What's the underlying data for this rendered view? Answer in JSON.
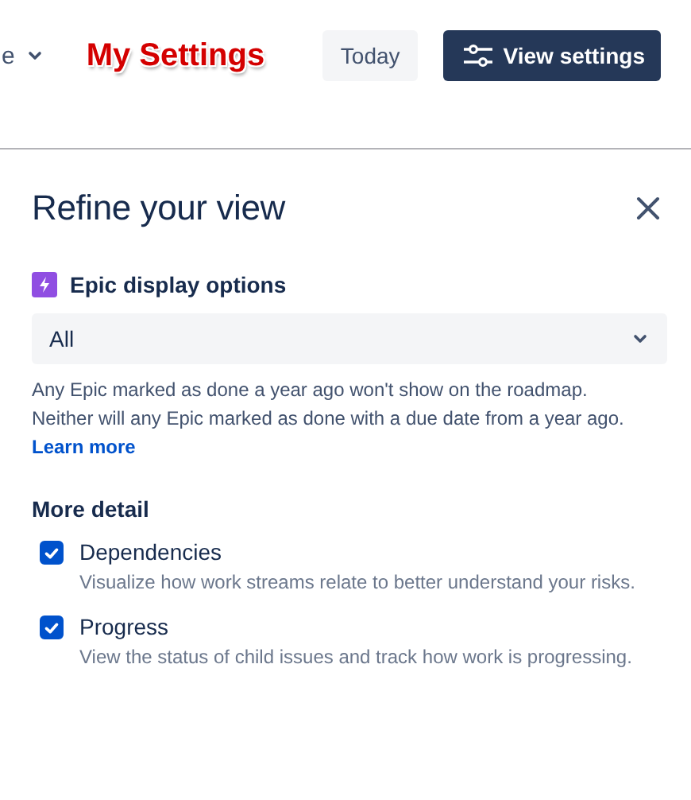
{
  "header": {
    "view_dropdown": {
      "label": "e"
    },
    "annotation": "My Settings",
    "buttons": [
      {
        "label": "Today",
        "kind": "subtle"
      },
      {
        "label": "View settings",
        "kind": "primary"
      }
    ]
  },
  "panel": {
    "title": "Refine your view",
    "epic_options": {
      "label": "Epic display options",
      "value": "All",
      "help": "Any Epic marked as done a year ago won't show on the roadmap. Neither will any Epic marked as done with a due date from a year ago.",
      "link": "Learn more"
    },
    "more_detail": {
      "heading": "More detail",
      "options": [
        {
          "label": "Dependencies",
          "description": "Visualize how work streams relate to better understand your risks.",
          "checked": true
        },
        {
          "label": "Progress",
          "description": "View the status of child issues and track how work is progressing.",
          "checked": true
        }
      ]
    }
  }
}
